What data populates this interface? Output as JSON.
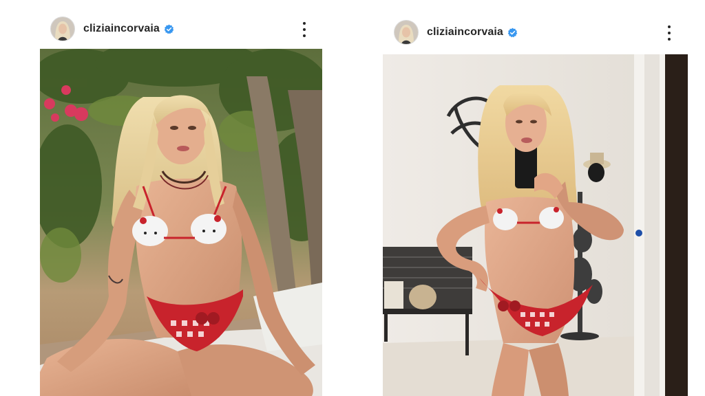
{
  "posts": [
    {
      "username": "cliziaincorvaia",
      "verified": true,
      "avatar_icon": "avatar-icon",
      "more_icon": "more-options-icon",
      "photo_desc_icon": "garden-portrait-photo"
    },
    {
      "username": "cliziaincorvaia",
      "verified": true,
      "avatar_icon": "avatar-icon",
      "more_icon": "more-options-icon",
      "photo_desc_icon": "mirror-selfie-photo"
    }
  ],
  "colors": {
    "username": "#262626",
    "verified_badge": "#3897f0",
    "bikini_red": "#c8232c"
  }
}
